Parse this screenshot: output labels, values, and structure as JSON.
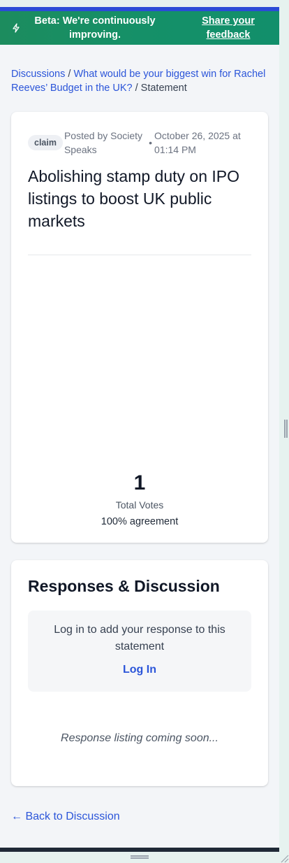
{
  "banner": {
    "icon": "bolt-icon",
    "message": "Beta: We're continuously improving.",
    "link_label": "Share your feedback"
  },
  "breadcrumb": {
    "root": "Discussions",
    "separator": "/",
    "discussion": "What would be your biggest win for Rachel Reeves’ Budget in the UK?",
    "current": "Statement"
  },
  "statement": {
    "badge": "claim",
    "posted_by": "Posted by Society Speaks",
    "separator": "•",
    "date": "October 26, 2025 at 01:14 PM",
    "title": "Abolishing stamp duty on IPO listings to boost UK public markets",
    "total_votes": "1",
    "total_votes_label": "Total Votes",
    "agreement": "100% agreement"
  },
  "responses": {
    "title": "Responses & Discussion",
    "login_prompt": "Log in to add your response to this statement",
    "login_button": "Log In",
    "placeholder": "Response listing coming soon..."
  },
  "back_link": "← Back to Discussion",
  "colors": {
    "banner_green": "#159068",
    "link_blue": "#2b55d9",
    "top_rule": "#2b4cd6"
  }
}
